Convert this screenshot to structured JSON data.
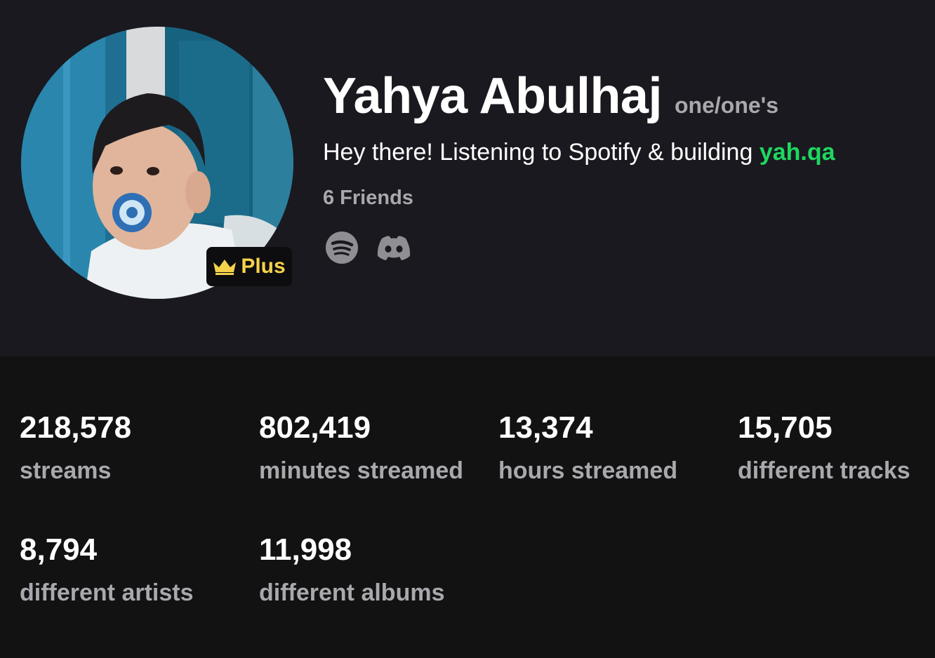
{
  "profile": {
    "display_name": "Yahya Abulhaj",
    "pronouns": "one/one's",
    "bio_text": "Hey there! Listening to Spotify & building ",
    "bio_link": "yah.qa",
    "friends": "6 Friends",
    "badge_label": "Plus",
    "badge_icon": "crown-icon",
    "avatar": "profile-photo",
    "socials": [
      "spotify-icon",
      "discord-icon"
    ]
  },
  "colors": {
    "header_bg": "#1a191f",
    "stats_bg": "#121212",
    "accent_green": "#1ed760",
    "badge_gold": "#f5d24b",
    "muted_text": "#a8a8ad"
  },
  "stats": [
    {
      "value": "218,578",
      "label": "streams"
    },
    {
      "value": "802,419",
      "label": "minutes streamed"
    },
    {
      "value": "13,374",
      "label": "hours streamed"
    },
    {
      "value": "15,705",
      "label": "different tracks"
    },
    {
      "value": "8,794",
      "label": "different artists"
    },
    {
      "value": "11,998",
      "label": "different albums"
    }
  ]
}
